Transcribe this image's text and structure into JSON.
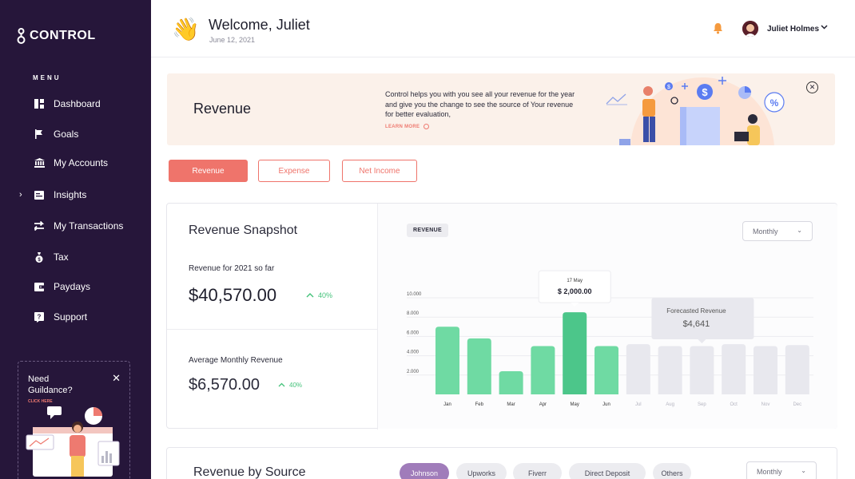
{
  "app": {
    "logo_text": "CONTROL",
    "menu_label": "MENU"
  },
  "sidebar": {
    "items": [
      {
        "label": "Dashboard",
        "icon": "dashboard-icon"
      },
      {
        "label": "Goals",
        "icon": "flag-icon"
      },
      {
        "label": "My Accounts",
        "icon": "bank-icon"
      },
      {
        "label": "Insights",
        "icon": "insights-icon"
      },
      {
        "label": "My Transactions",
        "icon": "transfer-icon"
      },
      {
        "label": "Tax",
        "icon": "money-bag-icon"
      },
      {
        "label": "Paydays",
        "icon": "wallet-icon"
      },
      {
        "label": "Support",
        "icon": "help-icon"
      }
    ],
    "guide": {
      "title": "Need Guildance?",
      "cta": "CLICK HERE"
    }
  },
  "header": {
    "welcome": "Welcome, Juliet",
    "date": "June 12, 2021",
    "username": "Juliet Holmes"
  },
  "banner": {
    "title": "Revenue",
    "text": "Control helps you with you see all your revenue for the year and give you the change to see the source of Your revenue for better evaluation,",
    "link": "LEARN MORE"
  },
  "tabs": [
    {
      "label": "Revenue",
      "active": true
    },
    {
      "label": "Expense",
      "active": false
    },
    {
      "label": "Net Income",
      "active": false
    }
  ],
  "snapshot": {
    "title": "Revenue Snapshot",
    "ytd_label": "Revenue for 2021 so far",
    "ytd_value": "$40,570.00",
    "ytd_change": "40%",
    "avg_label": "Average Monthly Revenue",
    "avg_value": "$6,570.00",
    "avg_change": "40%",
    "chip": "REVENUE",
    "period": "Monthly"
  },
  "chart_data": {
    "type": "bar",
    "categories": [
      "Jan",
      "Feb",
      "Mar",
      "Apr",
      "May",
      "Jun",
      "Jul",
      "Aug",
      "Sep",
      "Oct",
      "Nov",
      "Dec"
    ],
    "values": [
      7000,
      5800,
      2400,
      5000,
      8500,
      5000,
      5200,
      5000,
      5000,
      5200,
      5000,
      5100
    ],
    "forecast_start_index": 6,
    "yticks": [
      "10.000",
      "8.000",
      "6.000",
      "4.000",
      "2.000"
    ],
    "ylim": [
      0,
      10000
    ],
    "tooltip": {
      "date": "17 May",
      "value": "$ 2,000.00"
    },
    "forecast_tooltip": {
      "label": "Forecasted Revenue",
      "value": "$4,641"
    },
    "colors": {
      "actual": "#6fdaa3",
      "highlight": "#4cc68a",
      "forecast": "#e8e8ee"
    }
  },
  "source": {
    "title": "Revenue by Source",
    "pills": [
      {
        "label": "Johnson",
        "active": true
      },
      {
        "label": "Upworks",
        "active": false
      },
      {
        "label": "Fiverr",
        "active": false
      },
      {
        "label": "Direct Deposit",
        "active": false
      },
      {
        "label": "Others",
        "active": false
      }
    ],
    "period": "Monthly"
  },
  "colors": {
    "sidebar": "#26163a",
    "accent": "#ef746b",
    "positive": "#44c27a"
  }
}
